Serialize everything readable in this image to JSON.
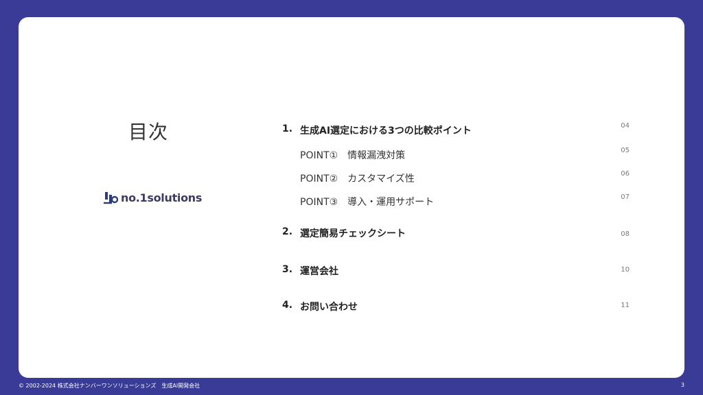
{
  "toc_title": "目次",
  "logo": {
    "text": "no.1solutions",
    "icon": "logo-mark-icon"
  },
  "items": [
    {
      "num": "1.",
      "label": "生成AI選定における3つの比較ポイント",
      "page": "04"
    },
    {
      "num": "",
      "label": "POINT①　情報漏洩対策",
      "page": "05"
    },
    {
      "num": "",
      "label": "POINT②　カスタマイズ性",
      "page": "06"
    },
    {
      "num": "",
      "label": "POINT③　導入・運用サポート",
      "page": "07"
    },
    {
      "num": "2.",
      "label": "選定簡易チェックシート",
      "page": "08"
    },
    {
      "num": "3.",
      "label": "運営会社",
      "page": "10"
    },
    {
      "num": "4.",
      "label": "お問い合わせ",
      "page": "11"
    }
  ],
  "footer": {
    "copyright": "© 2002-2024 株式会社ナンバーワンソリューションズ　生成AI開発会社",
    "page_number": "3"
  },
  "colors": {
    "background": "#3a3b97",
    "card": "#ffffff",
    "logo": "#2c3e7a"
  }
}
